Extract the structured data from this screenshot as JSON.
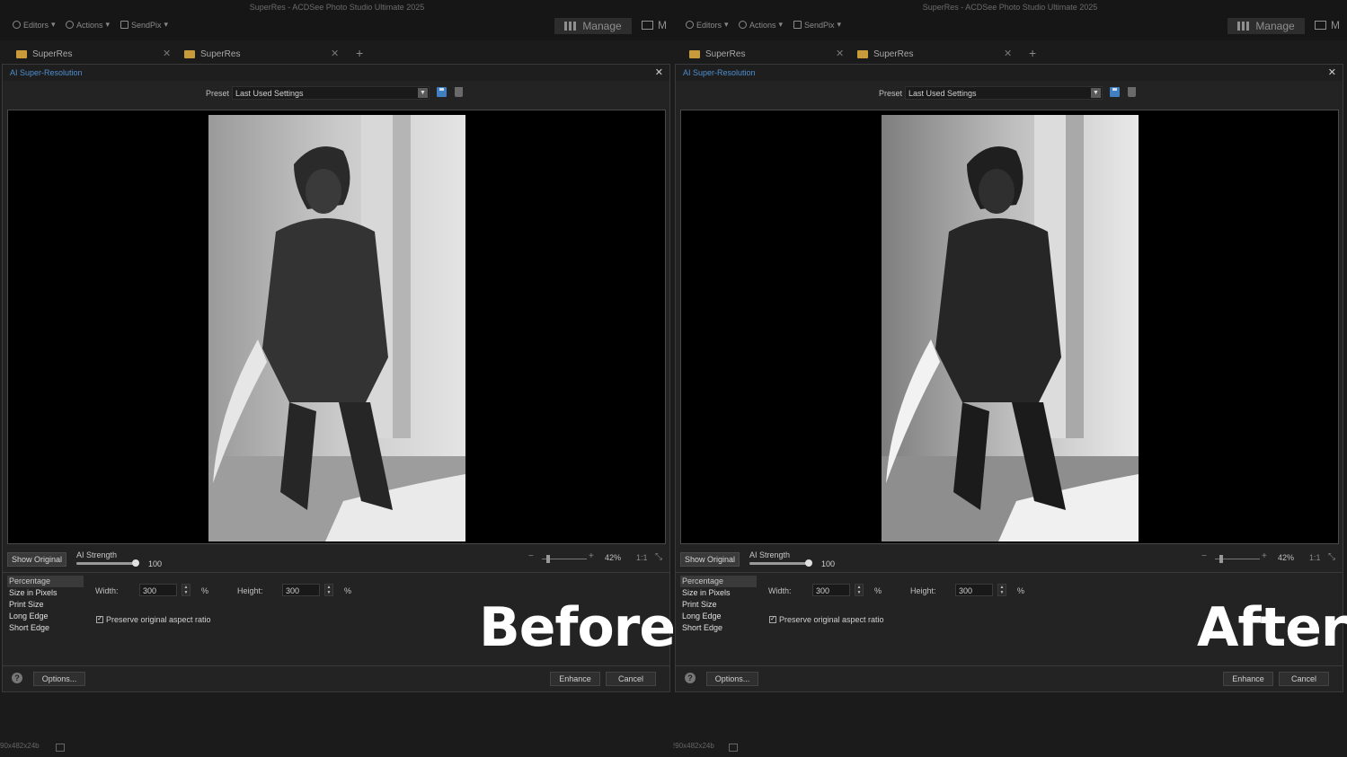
{
  "app": {
    "title": "SuperRes - ACDSee Photo Studio Ultimate 2025",
    "toolbar": {
      "editors": "Editors",
      "actions": "Actions",
      "sendpix": "SendPix"
    },
    "mode_manage": "Manage",
    "mode_next": "M"
  },
  "tabs": [
    {
      "label": "SuperRes"
    },
    {
      "label": "SuperRes"
    }
  ],
  "dialog": {
    "title": "AI Super-Resolution",
    "preset_label": "Preset",
    "preset_value": "Last Used Settings",
    "show_original": "Show Original",
    "ai_strength_label": "AI Strength",
    "ai_strength_value": "100",
    "ai_strength_fraction": 1.0,
    "zoom_minus": "−",
    "zoom_plus": "+",
    "zoom_percent": "42%",
    "zoom_1to1": "1:1",
    "size_modes": [
      "Percentage",
      "Size in Pixels",
      "Print Size",
      "Long Edge",
      "Short Edge"
    ],
    "selected_mode": "Percentage",
    "width_label": "Width:",
    "width_value": "300",
    "height_label": "Height:",
    "height_value": "300",
    "unit": "%",
    "preserve_aspect": "Preserve original aspect ratio",
    "preserve_checked": true,
    "help": "?",
    "options": "Options...",
    "enhance": "Enhance",
    "cancel": "Cancel"
  },
  "status": {
    "info": "90x482x24b",
    "info_right": "!90x482x24b"
  },
  "overlay": {
    "before": "Before",
    "after": "After"
  },
  "colors": {
    "accent": "#4d8fd0",
    "folder": "#c99a3a",
    "background": "#1b1b1b"
  }
}
